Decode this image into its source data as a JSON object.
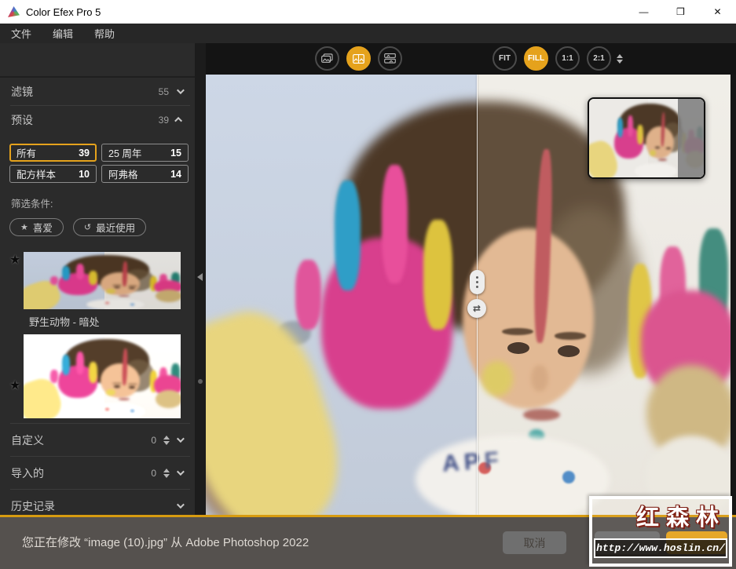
{
  "colors": {
    "accent": "#E5A21C",
    "footer_line": "#D79B10",
    "titlebar_bg": "#FFFFFF",
    "menubar_bg": "#272727",
    "sidebar_bg": "#2B2B2B",
    "footer_bg": "#55514E"
  },
  "window": {
    "title": "Color Efex Pro 5",
    "minimize_glyph": "—",
    "maximize_glyph": "❒",
    "close_glyph": "✕"
  },
  "menu": {
    "items": [
      {
        "label": "文件"
      },
      {
        "label": "编辑"
      },
      {
        "label": "帮助"
      }
    ]
  },
  "sidebar": {
    "filters_label": "滤镜",
    "filters_count": "55",
    "presets_label": "预设",
    "presets_count": "39",
    "categories": [
      {
        "label": "所有",
        "count": "39"
      },
      {
        "label": "25 周年",
        "count": "15"
      },
      {
        "label": "配方样本",
        "count": "10"
      },
      {
        "label": "阿弗格",
        "count": "14"
      }
    ],
    "filter_by_label": "筛选条件:",
    "favorites_label": "喜爱",
    "recent_label": "最近使用",
    "favorites_icon": "★",
    "recent_icon": "↺",
    "preset1_label": "野生动物 - 暗处",
    "star_icon": "★",
    "custom_label": "自定义",
    "custom_count": "0",
    "imported_label": "导入的",
    "imported_count": "0",
    "history_label": "历史记录"
  },
  "toolbar": {
    "zoom_fit": "FIT",
    "zoom_fill": "FILL",
    "zoom_1to1": "1:1",
    "zoom_2to1": "2:1"
  },
  "canvas": {
    "swap_icon": "⇄"
  },
  "footer": {
    "status": "您正在修改 “image (10).jpg” 从 Adobe Photoshop 2022",
    "cancel_label": "取消"
  },
  "watermark": {
    "title": "红森林",
    "url": "http://www.hoslin.cn/"
  }
}
